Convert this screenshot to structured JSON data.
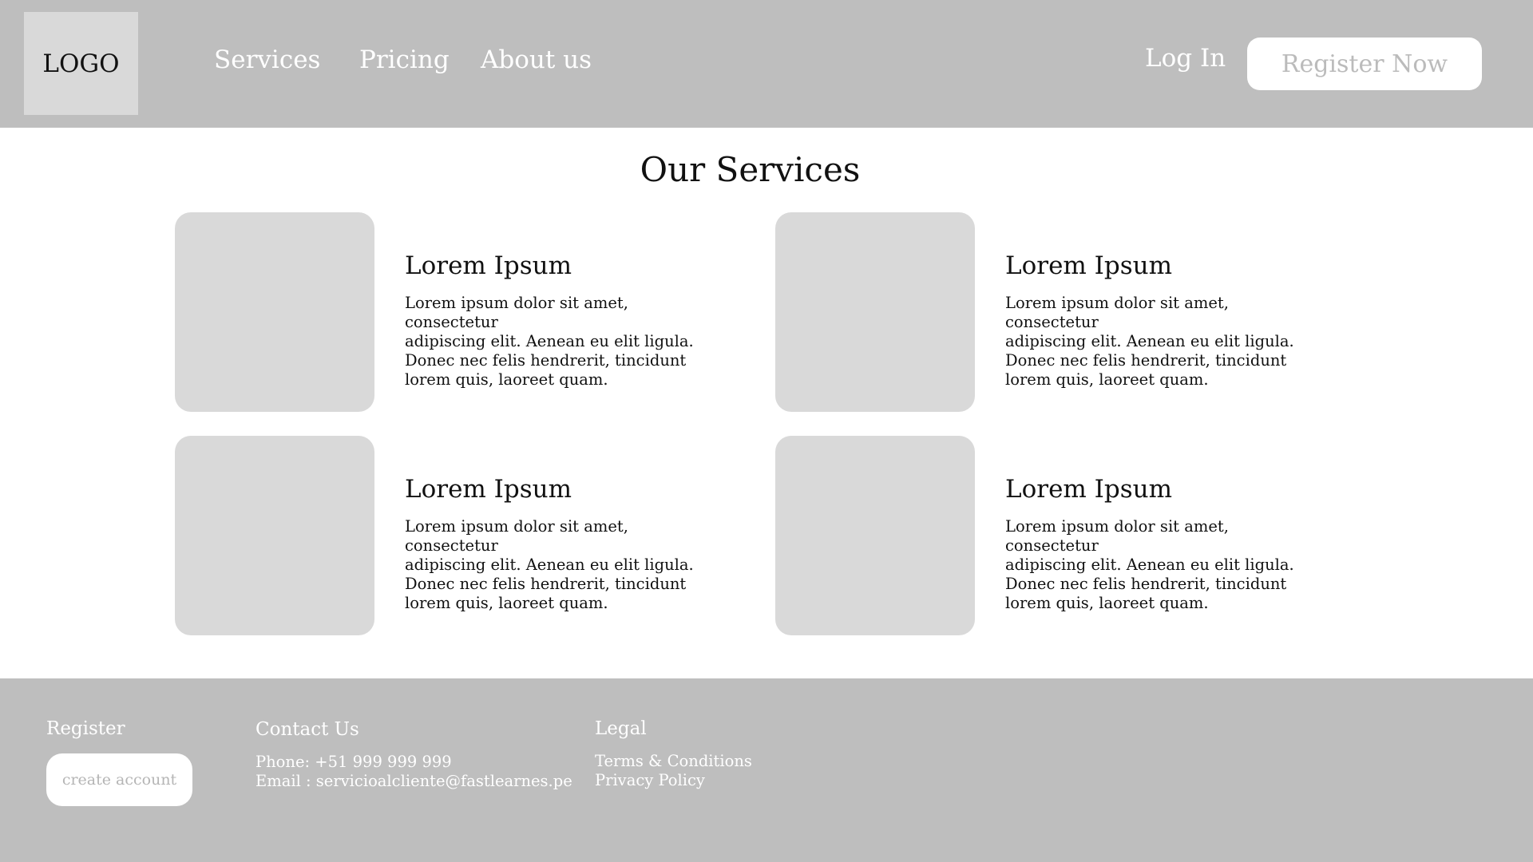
{
  "header": {
    "logo": "LOGO",
    "nav": {
      "services": "Services",
      "pricing": "Pricing",
      "about": "About us"
    },
    "login": "Log In",
    "register": "Register Now"
  },
  "main": {
    "title": "Our Services",
    "cards": [
      {
        "title": "Lorem Ipsum",
        "lines": [
          "Lorem ipsum dolor sit amet, consectetur",
          "adipiscing elit. Aenean eu elit  ligula.",
          "Donec nec felis hendrerit, tincidunt",
          "lorem quis, laoreet quam."
        ]
      },
      {
        "title": "Lorem Ipsum",
        "lines": [
          "Lorem ipsum dolor sit amet, consectetur",
          "adipiscing elit. Aenean eu elit  ligula.",
          "Donec nec felis hendrerit, tincidunt",
          "lorem quis, laoreet quam."
        ]
      },
      {
        "title": "Lorem Ipsum",
        "lines": [
          "Lorem ipsum dolor sit amet, consectetur",
          "adipiscing elit. Aenean eu elit  ligula.",
          "Donec nec felis hendrerit, tincidunt",
          "lorem quis, laoreet quam."
        ]
      },
      {
        "title": "Lorem Ipsum",
        "lines": [
          "Lorem ipsum dolor sit amet, consectetur",
          "adipiscing elit. Aenean eu elit  ligula.",
          "Donec nec felis hendrerit, tincidunt",
          "lorem quis, laoreet quam."
        ]
      }
    ]
  },
  "footer": {
    "register": {
      "heading": "Register",
      "button": "create account"
    },
    "contact": {
      "heading": "Contact Us",
      "phone": "Phone: +51 999 999 999",
      "email": "Email : servicioalcliente@fastlearnes.pe"
    },
    "legal": {
      "heading": "Legal",
      "terms": "Terms & Conditions",
      "privacy": "Privacy Policy"
    }
  },
  "colors": {
    "header_bg": "#bebebe",
    "placeholder": "#d9d9d9",
    "button_bg": "#ffffff"
  }
}
